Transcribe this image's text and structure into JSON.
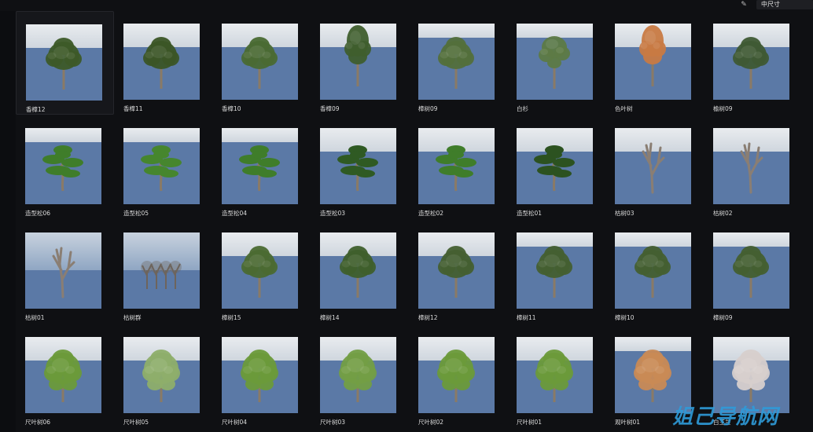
{
  "toolbar": {
    "edit_icon": "pencil-icon",
    "size_option": "中尺寸"
  },
  "assets": [
    {
      "label": "香樟12",
      "kind": "round",
      "foliage": "#3d5a28",
      "sky": "tall"
    },
    {
      "label": "香樟11",
      "kind": "round",
      "foliage": "#3b5526",
      "sky": "tall"
    },
    {
      "label": "香樟10",
      "kind": "round",
      "foliage": "#4a6a33",
      "sky": "tall"
    },
    {
      "label": "香樟09",
      "kind": "tall",
      "foliage": "#3f5e2d",
      "sky": "tall"
    },
    {
      "label": "樟树09",
      "kind": "round",
      "foliage": "#536f3b",
      "sky": "short"
    },
    {
      "label": "白杉",
      "kind": "sparse",
      "foliage": "#5d7a45",
      "sky": "short"
    },
    {
      "label": "色叶树",
      "kind": "tall",
      "foliage": "#c87a43",
      "sky": "tall"
    },
    {
      "label": "榆树09",
      "kind": "round",
      "foliage": "#3f5a34",
      "sky": "tall"
    },
    {
      "label": "造型松06",
      "kind": "pine",
      "foliage": "#3f7d2a",
      "sky": "short"
    },
    {
      "label": "造型松05",
      "kind": "pine",
      "foliage": "#46862e",
      "sky": "short"
    },
    {
      "label": "造型松04",
      "kind": "pine",
      "foliage": "#3f7d2a",
      "sky": "short"
    },
    {
      "label": "造型松03",
      "kind": "pine",
      "foliage": "#2f5a23",
      "sky": "tall"
    },
    {
      "label": "造型松02",
      "kind": "pine",
      "foliage": "#3f7d2a",
      "sky": "tall"
    },
    {
      "label": "造型松01",
      "kind": "pine",
      "foliage": "#2c5220",
      "sky": "tall"
    },
    {
      "label": "枯树03",
      "kind": "dead",
      "foliage": "#8a7e73",
      "sky": "tall"
    },
    {
      "label": "枯树02",
      "kind": "dead",
      "foliage": "#8a7e73",
      "sky": "tall"
    },
    {
      "label": "枯树01",
      "kind": "dead",
      "foliage": "#8a7e73",
      "sky": "cloudy"
    },
    {
      "label": "枯树群",
      "kind": "group",
      "foliage": "#6e645c",
      "sky": "cloudy"
    },
    {
      "label": "樟树15",
      "kind": "round",
      "foliage": "#4b6a32",
      "sky": "tall"
    },
    {
      "label": "樟树14",
      "kind": "round",
      "foliage": "#3f5f2c",
      "sky": "tall"
    },
    {
      "label": "樟树12",
      "kind": "round",
      "foliage": "#445f30",
      "sky": "tall"
    },
    {
      "label": "樟树11",
      "kind": "round",
      "foliage": "#445f30",
      "sky": "short"
    },
    {
      "label": "樟树10",
      "kind": "round",
      "foliage": "#445f30",
      "sky": "short"
    },
    {
      "label": "樟树09",
      "kind": "round",
      "foliage": "#445f30",
      "sky": "short"
    },
    {
      "label": "尺叶树06",
      "kind": "broad",
      "foliage": "#6b9a3a",
      "sky": "tall"
    },
    {
      "label": "尺叶树05",
      "kind": "broad",
      "foliage": "#8eae6a",
      "sky": "tall"
    },
    {
      "label": "尺叶树04",
      "kind": "broad",
      "foliage": "#6b9a3a",
      "sky": "tall"
    },
    {
      "label": "尺叶树03",
      "kind": "broad",
      "foliage": "#739e44",
      "sky": "tall"
    },
    {
      "label": "尺叶树02",
      "kind": "broad",
      "foliage": "#6b9a3a",
      "sky": "tall"
    },
    {
      "label": "尺叶树01",
      "kind": "broad",
      "foliage": "#6b9a3a",
      "sky": "tall"
    },
    {
      "label": "观叶树01",
      "kind": "broad",
      "foliage": "#c98a55",
      "sky": "short"
    },
    {
      "label": "白玉兰",
      "kind": "broad",
      "foliage": "#d7cfcc",
      "sky": "tall"
    }
  ],
  "watermark": "姐己导航网"
}
